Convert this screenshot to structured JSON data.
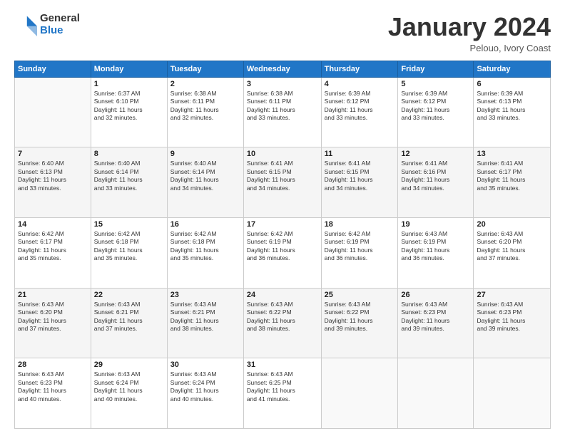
{
  "logo": {
    "general": "General",
    "blue": "Blue"
  },
  "header": {
    "month": "January 2024",
    "location": "Pelouo, Ivory Coast"
  },
  "weekdays": [
    "Sunday",
    "Monday",
    "Tuesday",
    "Wednesday",
    "Thursday",
    "Friday",
    "Saturday"
  ],
  "weeks": [
    [
      {
        "day": "",
        "info": ""
      },
      {
        "day": "1",
        "info": "Sunrise: 6:37 AM\nSunset: 6:10 PM\nDaylight: 11 hours\nand 32 minutes."
      },
      {
        "day": "2",
        "info": "Sunrise: 6:38 AM\nSunset: 6:11 PM\nDaylight: 11 hours\nand 32 minutes."
      },
      {
        "day": "3",
        "info": "Sunrise: 6:38 AM\nSunset: 6:11 PM\nDaylight: 11 hours\nand 33 minutes."
      },
      {
        "day": "4",
        "info": "Sunrise: 6:39 AM\nSunset: 6:12 PM\nDaylight: 11 hours\nand 33 minutes."
      },
      {
        "day": "5",
        "info": "Sunrise: 6:39 AM\nSunset: 6:12 PM\nDaylight: 11 hours\nand 33 minutes."
      },
      {
        "day": "6",
        "info": "Sunrise: 6:39 AM\nSunset: 6:13 PM\nDaylight: 11 hours\nand 33 minutes."
      }
    ],
    [
      {
        "day": "7",
        "info": "Sunrise: 6:40 AM\nSunset: 6:13 PM\nDaylight: 11 hours\nand 33 minutes."
      },
      {
        "day": "8",
        "info": "Sunrise: 6:40 AM\nSunset: 6:14 PM\nDaylight: 11 hours\nand 33 minutes."
      },
      {
        "day": "9",
        "info": "Sunrise: 6:40 AM\nSunset: 6:14 PM\nDaylight: 11 hours\nand 34 minutes."
      },
      {
        "day": "10",
        "info": "Sunrise: 6:41 AM\nSunset: 6:15 PM\nDaylight: 11 hours\nand 34 minutes."
      },
      {
        "day": "11",
        "info": "Sunrise: 6:41 AM\nSunset: 6:15 PM\nDaylight: 11 hours\nand 34 minutes."
      },
      {
        "day": "12",
        "info": "Sunrise: 6:41 AM\nSunset: 6:16 PM\nDaylight: 11 hours\nand 34 minutes."
      },
      {
        "day": "13",
        "info": "Sunrise: 6:41 AM\nSunset: 6:17 PM\nDaylight: 11 hours\nand 35 minutes."
      }
    ],
    [
      {
        "day": "14",
        "info": "Sunrise: 6:42 AM\nSunset: 6:17 PM\nDaylight: 11 hours\nand 35 minutes."
      },
      {
        "day": "15",
        "info": "Sunrise: 6:42 AM\nSunset: 6:18 PM\nDaylight: 11 hours\nand 35 minutes."
      },
      {
        "day": "16",
        "info": "Sunrise: 6:42 AM\nSunset: 6:18 PM\nDaylight: 11 hours\nand 35 minutes."
      },
      {
        "day": "17",
        "info": "Sunrise: 6:42 AM\nSunset: 6:19 PM\nDaylight: 11 hours\nand 36 minutes."
      },
      {
        "day": "18",
        "info": "Sunrise: 6:42 AM\nSunset: 6:19 PM\nDaylight: 11 hours\nand 36 minutes."
      },
      {
        "day": "19",
        "info": "Sunrise: 6:43 AM\nSunset: 6:19 PM\nDaylight: 11 hours\nand 36 minutes."
      },
      {
        "day": "20",
        "info": "Sunrise: 6:43 AM\nSunset: 6:20 PM\nDaylight: 11 hours\nand 37 minutes."
      }
    ],
    [
      {
        "day": "21",
        "info": "Sunrise: 6:43 AM\nSunset: 6:20 PM\nDaylight: 11 hours\nand 37 minutes."
      },
      {
        "day": "22",
        "info": "Sunrise: 6:43 AM\nSunset: 6:21 PM\nDaylight: 11 hours\nand 37 minutes."
      },
      {
        "day": "23",
        "info": "Sunrise: 6:43 AM\nSunset: 6:21 PM\nDaylight: 11 hours\nand 38 minutes."
      },
      {
        "day": "24",
        "info": "Sunrise: 6:43 AM\nSunset: 6:22 PM\nDaylight: 11 hours\nand 38 minutes."
      },
      {
        "day": "25",
        "info": "Sunrise: 6:43 AM\nSunset: 6:22 PM\nDaylight: 11 hours\nand 39 minutes."
      },
      {
        "day": "26",
        "info": "Sunrise: 6:43 AM\nSunset: 6:23 PM\nDaylight: 11 hours\nand 39 minutes."
      },
      {
        "day": "27",
        "info": "Sunrise: 6:43 AM\nSunset: 6:23 PM\nDaylight: 11 hours\nand 39 minutes."
      }
    ],
    [
      {
        "day": "28",
        "info": "Sunrise: 6:43 AM\nSunset: 6:23 PM\nDaylight: 11 hours\nand 40 minutes."
      },
      {
        "day": "29",
        "info": "Sunrise: 6:43 AM\nSunset: 6:24 PM\nDaylight: 11 hours\nand 40 minutes."
      },
      {
        "day": "30",
        "info": "Sunrise: 6:43 AM\nSunset: 6:24 PM\nDaylight: 11 hours\nand 40 minutes."
      },
      {
        "day": "31",
        "info": "Sunrise: 6:43 AM\nSunset: 6:25 PM\nDaylight: 11 hours\nand 41 minutes."
      },
      {
        "day": "",
        "info": ""
      },
      {
        "day": "",
        "info": ""
      },
      {
        "day": "",
        "info": ""
      }
    ]
  ]
}
